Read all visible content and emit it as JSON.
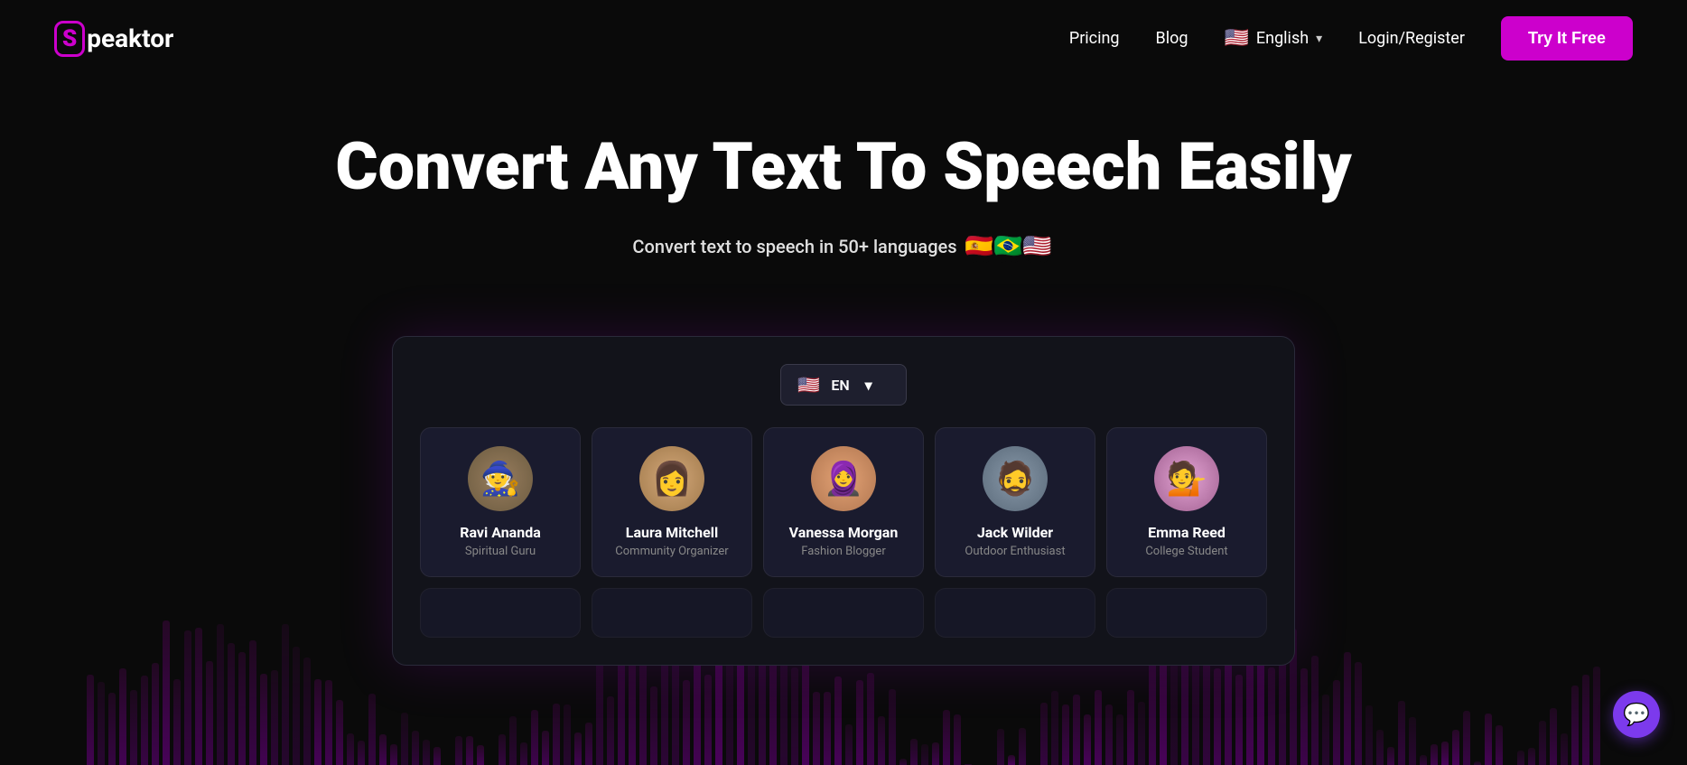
{
  "nav": {
    "logo_letter": "S",
    "logo_rest": "peaktor",
    "pricing_label": "Pricing",
    "blog_label": "Blog",
    "lang_label": "English",
    "login_label": "Login/Register",
    "cta_label": "Try It Free",
    "lang_flag": "🇺🇸"
  },
  "hero": {
    "title": "Convert Any Text To Speech Easily",
    "subtitle": "Convert text to speech in 50+ languages",
    "flags": [
      "🇪🇸",
      "🇧🇷",
      "🇺🇸"
    ]
  },
  "app": {
    "lang_code": "EN",
    "lang_flag": "🇺🇸"
  },
  "voices": [
    {
      "id": "ravi",
      "name": "Ravi Ananda",
      "role": "Spiritual Guru",
      "avatar_class": "avatar-ravi",
      "emoji": "🧙"
    },
    {
      "id": "laura",
      "name": "Laura Mitchell",
      "role": "Community Organizer",
      "avatar_class": "avatar-laura",
      "emoji": "👩"
    },
    {
      "id": "vanessa",
      "name": "Vanessa Morgan",
      "role": "Fashion Blogger",
      "avatar_class": "avatar-vanessa",
      "emoji": "🧕"
    },
    {
      "id": "jack",
      "name": "Jack Wilder",
      "role": "Outdoor Enthusiast",
      "avatar_class": "avatar-jack",
      "emoji": "🧔"
    },
    {
      "id": "emma",
      "name": "Emma Reed",
      "role": "College Student",
      "avatar_class": "avatar-emma",
      "emoji": "💁"
    }
  ],
  "waveform": {
    "bar_count": 120
  }
}
